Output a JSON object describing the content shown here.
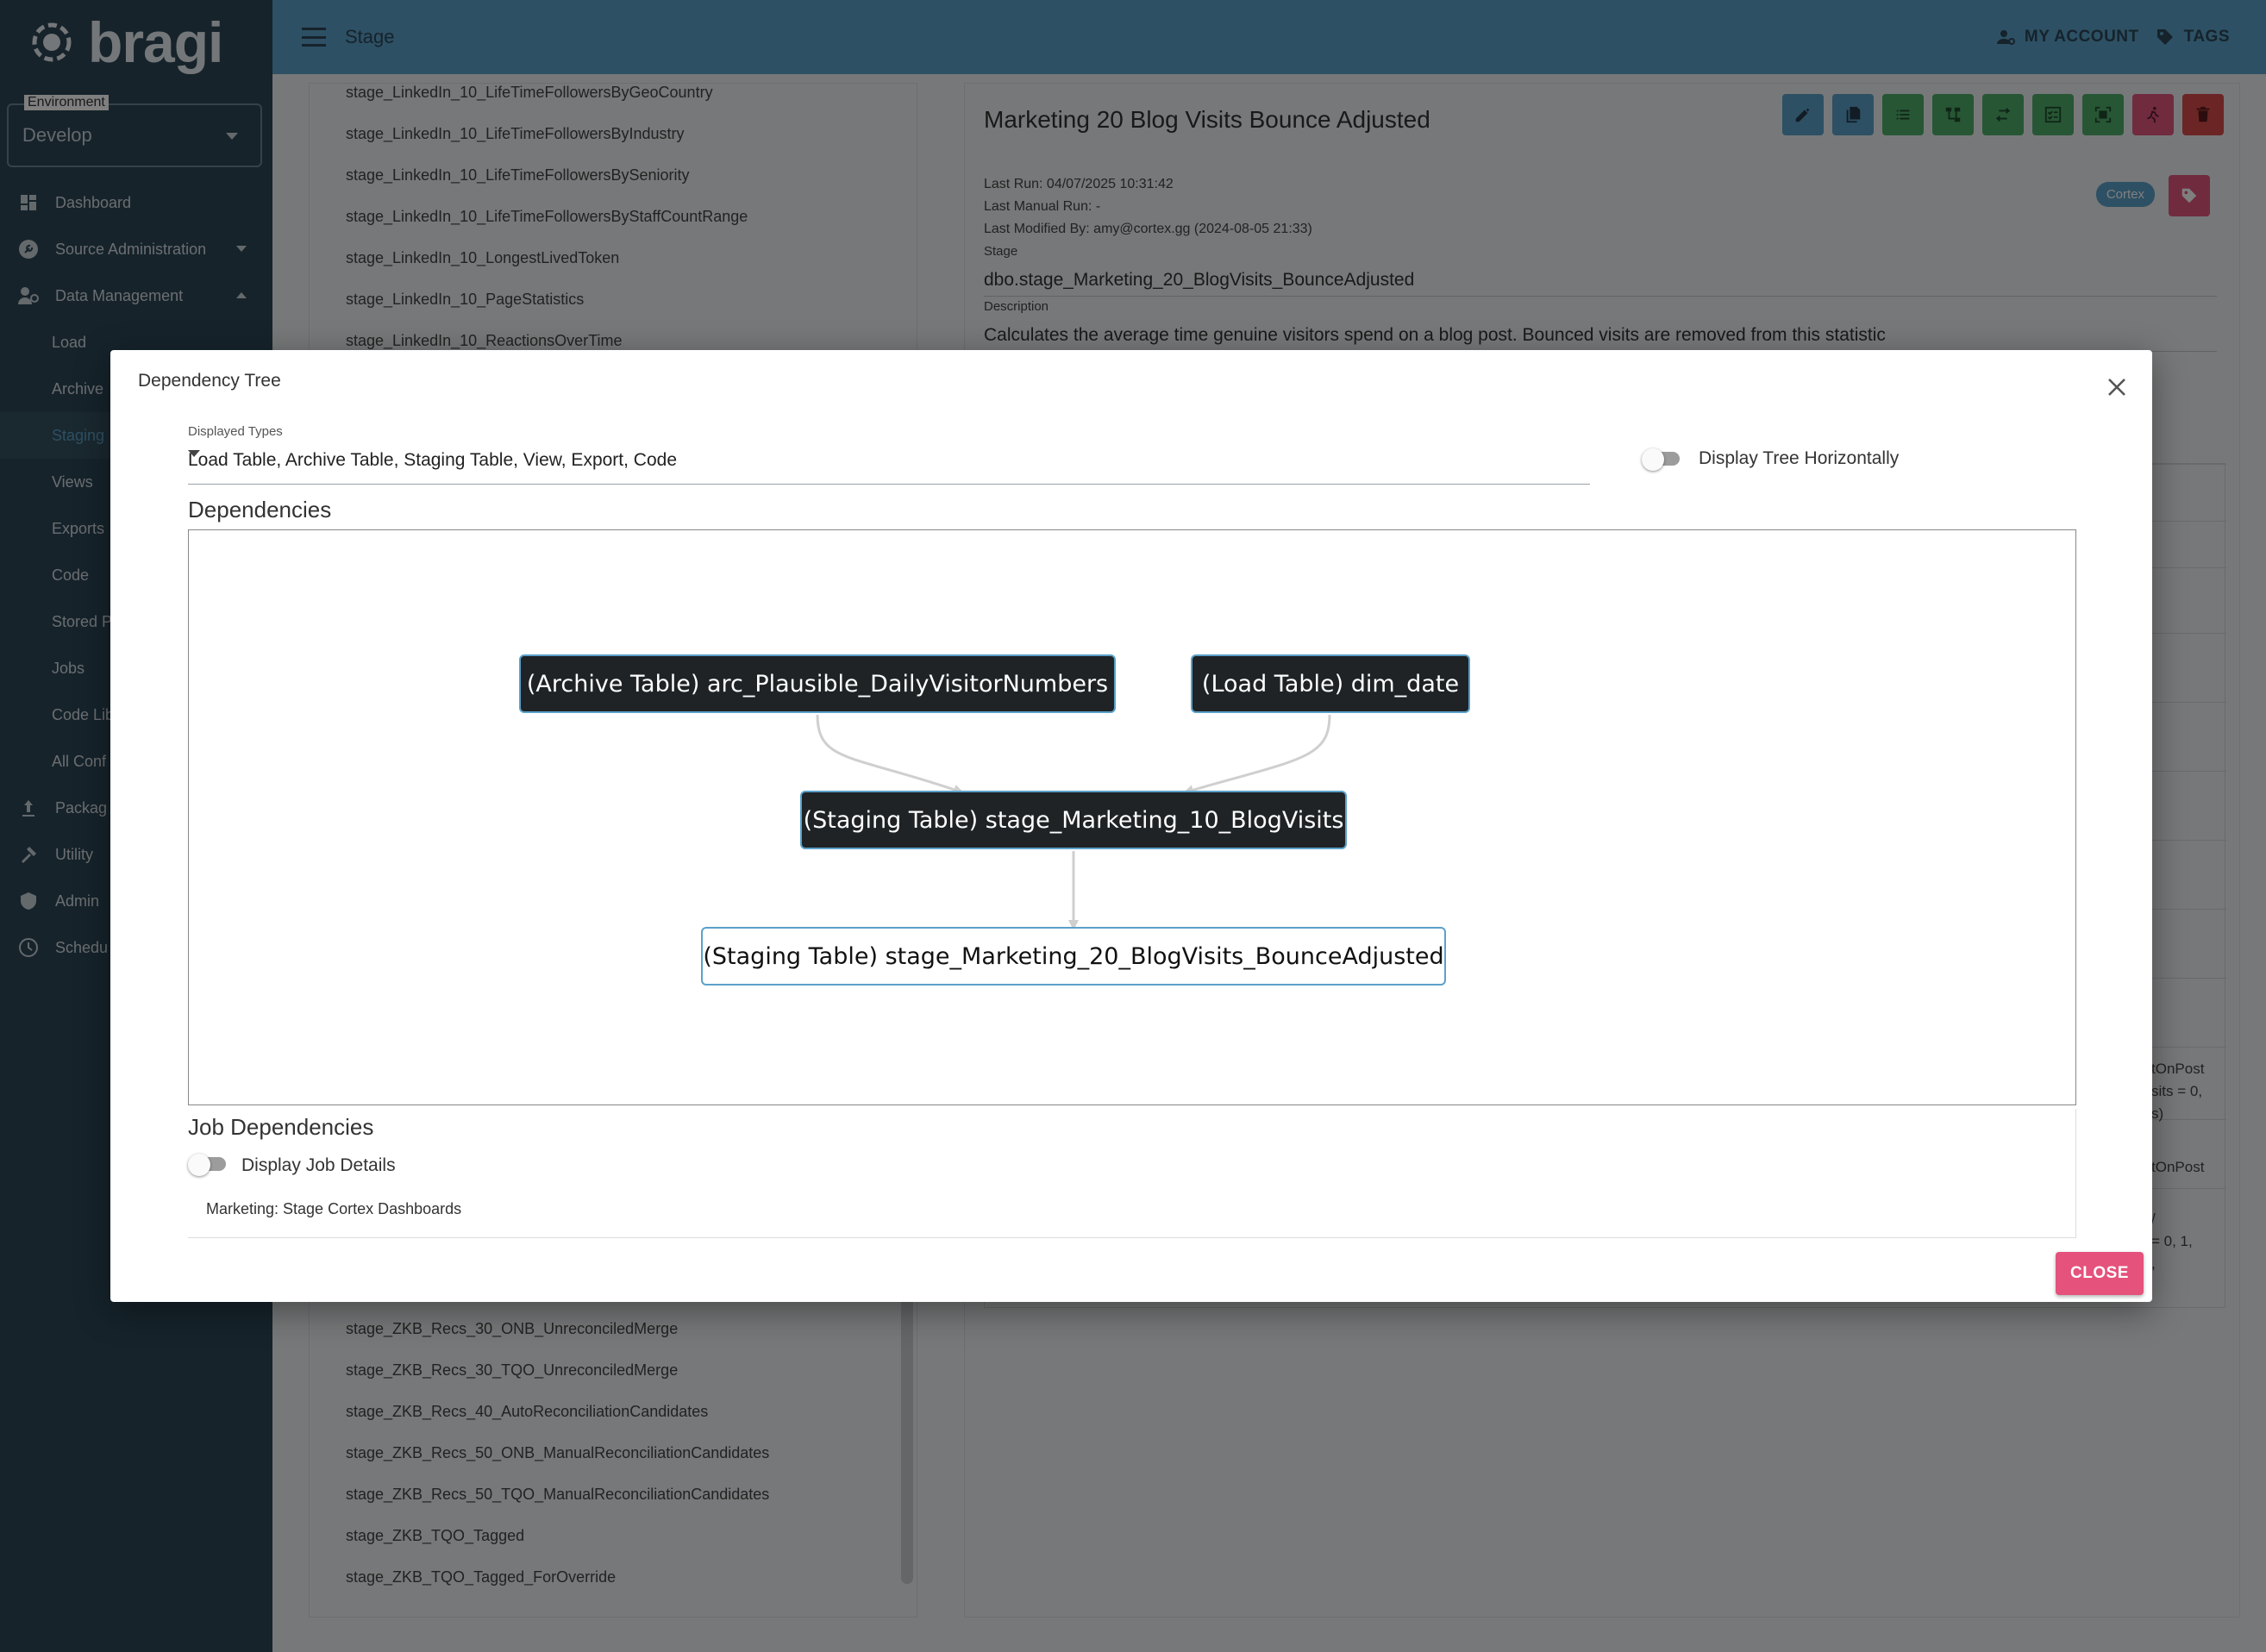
{
  "app": {
    "logo_text": "bragi"
  },
  "environment": {
    "label": "Environment",
    "value": "Develop"
  },
  "sidebar": {
    "items": [
      {
        "label": "Dashboard",
        "icon": "dashboard-icon"
      },
      {
        "label": "Source Administration",
        "icon": "wrench-icon"
      },
      {
        "label": "Data Management",
        "icon": "data-management-icon"
      },
      {
        "label": "Load"
      },
      {
        "label": "Archive"
      },
      {
        "label": "Staging"
      },
      {
        "label": "Views"
      },
      {
        "label": "Exports"
      },
      {
        "label": "Code"
      },
      {
        "label": "Stored P"
      },
      {
        "label": "Jobs"
      },
      {
        "label": "Code Lib"
      },
      {
        "label": "All Conf"
      },
      {
        "label": "Packag",
        "icon": "upload-icon"
      },
      {
        "label": "Utility",
        "icon": "hammer-icon"
      },
      {
        "label": "Admin",
        "icon": "admin-icon"
      },
      {
        "label": "Schedu",
        "icon": "clock-icon"
      }
    ]
  },
  "topbar": {
    "title": "Stage",
    "my_account": "MY ACCOUNT",
    "tags": "TAGS"
  },
  "stage_list": {
    "top_items": [
      "stage_LinkedIn_10_LifeTimeFollowersByGeoCountry",
      "stage_LinkedIn_10_LifeTimeFollowersByIndustry",
      "stage_LinkedIn_10_LifeTimeFollowersBySeniority",
      "stage_LinkedIn_10_LifeTimeFollowersByStaffCountRange",
      "stage_LinkedIn_10_LongestLivedToken",
      "stage_LinkedIn_10_PageStatistics",
      "stage_LinkedIn_10_ReactionsOverTime"
    ],
    "bottom_items": [
      "stage_ZKB_Recs_30_ONB_UnreconciledMerge",
      "stage_ZKB_Recs_30_TQO_UnreconciledMerge",
      "stage_ZKB_Recs_40_AutoReconciliationCandidates",
      "stage_ZKB_Recs_50_ONB_ManualReconciliationCandidates",
      "stage_ZKB_Recs_50_TQO_ManualReconciliationCandidates",
      "stage_ZKB_TQO_Tagged",
      "stage_ZKB_TQO_Tagged_ForOverride"
    ]
  },
  "detail": {
    "title": "Marketing 20 Blog Visits Bounce Adjusted",
    "last_run": "Last Run: 04/07/2025 10:31:42",
    "last_manual_run": "Last Manual Run: -",
    "last_modified": "Last Modified By: amy@cortex.gg (2024-08-05 21:33)",
    "tag_chip": "Cortex",
    "stage_label": "Stage",
    "stage_value": "dbo.stage_Marketing_20_BlogVisits_BounceAdjusted",
    "description_label": "Description",
    "description_value": "Calculates the average time genuine visitors spend on a blog post. Bounced visits are removed from this statistic",
    "right_fragments": [
      "tOnPost",
      "sits = 0,",
      "s)",
      "tOnPost",
      "/",
      "= 0, 1,",
      ","
    ]
  },
  "dialog": {
    "title": "Dependency Tree",
    "displayed_types_label": "Displayed Types",
    "displayed_types_value": "Load Table, Archive Table, Staging Table, View, Export, Code",
    "horizontal_toggle_label": "Display Tree Horizontally",
    "horizontal_toggle_on": false,
    "dependencies_title": "Dependencies",
    "nodes": [
      {
        "label": "(Archive Table) arc_Plausible_DailyVisitorNumbers"
      },
      {
        "label": "(Load Table) dim_date"
      },
      {
        "label": "(Staging Table) stage_Marketing_10_BlogVisits"
      },
      {
        "label": "(Staging Table) stage_Marketing_20_BlogVisits_BounceAdjusted"
      }
    ],
    "job_dependencies_title": "Job Dependencies",
    "job_details_toggle_label": "Display Job Details",
    "job_details_toggle_on": false,
    "jobs": [
      "Marketing: Stage Cortex Dashboards"
    ],
    "close_label": "CLOSE"
  }
}
